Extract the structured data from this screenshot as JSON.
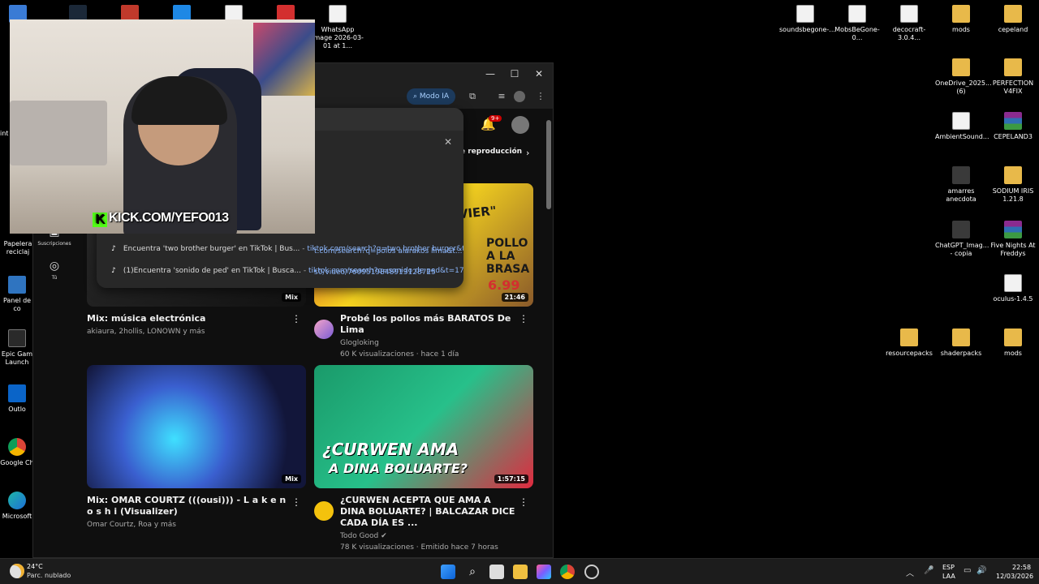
{
  "desktop": {
    "icons_right": [
      {
        "label": "soundsbegone-...",
        "icon": "java-jar-icon"
      },
      {
        "label": "MobsBeGone-0...",
        "icon": "java-jar-icon"
      },
      {
        "label": "decocraft-3.0.4...",
        "icon": "java-jar-icon"
      },
      {
        "label": "mods",
        "icon": "folder-icon"
      },
      {
        "label": "cepeland",
        "icon": "folder-icon"
      },
      {
        "label": "OneDrive_2025... (6)",
        "icon": "folder-icon"
      },
      {
        "label": "PERFECTION V4FIX",
        "icon": "folder-icon"
      },
      {
        "label": "AmbientSound...",
        "icon": "java-jar-icon"
      },
      {
        "label": "CEPELAND3",
        "icon": "winrar-icon"
      },
      {
        "label": "amarres anecdota",
        "icon": "file-icon"
      },
      {
        "label": "SODIUM IRIS 1.21.8",
        "icon": "folder-icon"
      },
      {
        "label": "ChatGPT_Imag... - copia",
        "icon": "image-icon"
      },
      {
        "label": "Five Nights At Freddys",
        "icon": "winrar-icon"
      },
      {
        "label": "oculus-1.4.5",
        "icon": "java-jar-icon"
      },
      {
        "label": "resourcepacks",
        "icon": "folder-icon"
      },
      {
        "label": "shaderpacks",
        "icon": "folder-icon"
      },
      {
        "label": "mods",
        "icon": "folder-icon"
      }
    ],
    "icons_left": [
      {
        "label": "WhatsApp Image 2026-03-01 at 1...",
        "icon": "image-icon"
      },
      {
        "label": "int",
        "icon": "file-icon"
      },
      {
        "label": "Papelera reciclaj",
        "icon": "recycle-bin-icon"
      },
      {
        "label": "Panel de co",
        "icon": "control-panel-icon"
      },
      {
        "label": "Epic Gam Launch",
        "icon": "epic-games-icon"
      },
      {
        "label": "Outlo",
        "icon": "outlook-icon"
      },
      {
        "label": "Google Ch",
        "icon": "chrome-icon"
      },
      {
        "label": "Microsoft",
        "icon": "edge-icon"
      }
    ]
  },
  "webcam": {
    "overlay_text": "KICK.COM/YEFO013"
  },
  "browser": {
    "toolbar": {
      "modo_ia": "Modo IA"
    },
    "notification_badge": "9+",
    "chip_playlist": "e reproducción",
    "sidebar": [
      {
        "label": "Suscripciones",
        "icon": "subscriptions-icon"
      },
      {
        "label": "Tú",
        "icon": "user-circle-icon"
      }
    ],
    "omnibox": {
      "suggestions": [
        {
          "title": "",
          "url": "t.com/search?q=polos alarakos lima&t..."
        },
        {
          "title": "",
          "url": "s0/video/7609519848913128715"
        },
        {
          "title": "Encuentra 'two brother burger' en TikTok | Bus...",
          "sep": " - ",
          "url": "tiktok.com/search?q=two brother burger&t..."
        },
        {
          "title": "(1)Encuentra 'sonido de ped' en TikTok | Busca...",
          "sep": " - ",
          "url": "tiktok.com/search?q=sonido de ped&t=17..."
        }
      ]
    },
    "videos": [
      {
        "title": "Mix: música electrónica",
        "meta1": "akiaura, 2hollis, LONOWN y más",
        "meta2": "",
        "badge": "Mix"
      },
      {
        "title": "Probé los pollos más BARATOS De Lima",
        "meta1": "Glogloking",
        "meta2": "60 K visualizaciones · hace 1 día",
        "badge": "21:46",
        "thumb_text1": "POLLO A LA BRASA",
        "thumb_text2": "6.99",
        "thumb_text3": "RIA \"JAVIER\""
      },
      {
        "title": "Mix: OMAR COURTZ (((ousi))) - L a k e n o s h i (Visualizer)",
        "meta1": "Omar Courtz, Roa y más",
        "meta2": "",
        "badge": "Mix"
      },
      {
        "title": "¿CURWEN ACEPTA QUE AMA A DINA BOLUARTE? | BALCAZAR DICE CADA DÍA ES ...",
        "meta1": "Todo Good ✔",
        "meta2": "78 K visualizaciones · Emitido hace 7 horas",
        "badge": "1:57:15",
        "thumb_text1": "¿CURWEN AMA",
        "thumb_text2": "A DINA BOLUARTE?"
      }
    ]
  },
  "taskbar": {
    "weather_temp": "24°C",
    "weather_desc": "Parc. nublado",
    "lang1": "ESP",
    "lang2": "LAA",
    "time": "22:58",
    "date": "12/03/2026"
  }
}
